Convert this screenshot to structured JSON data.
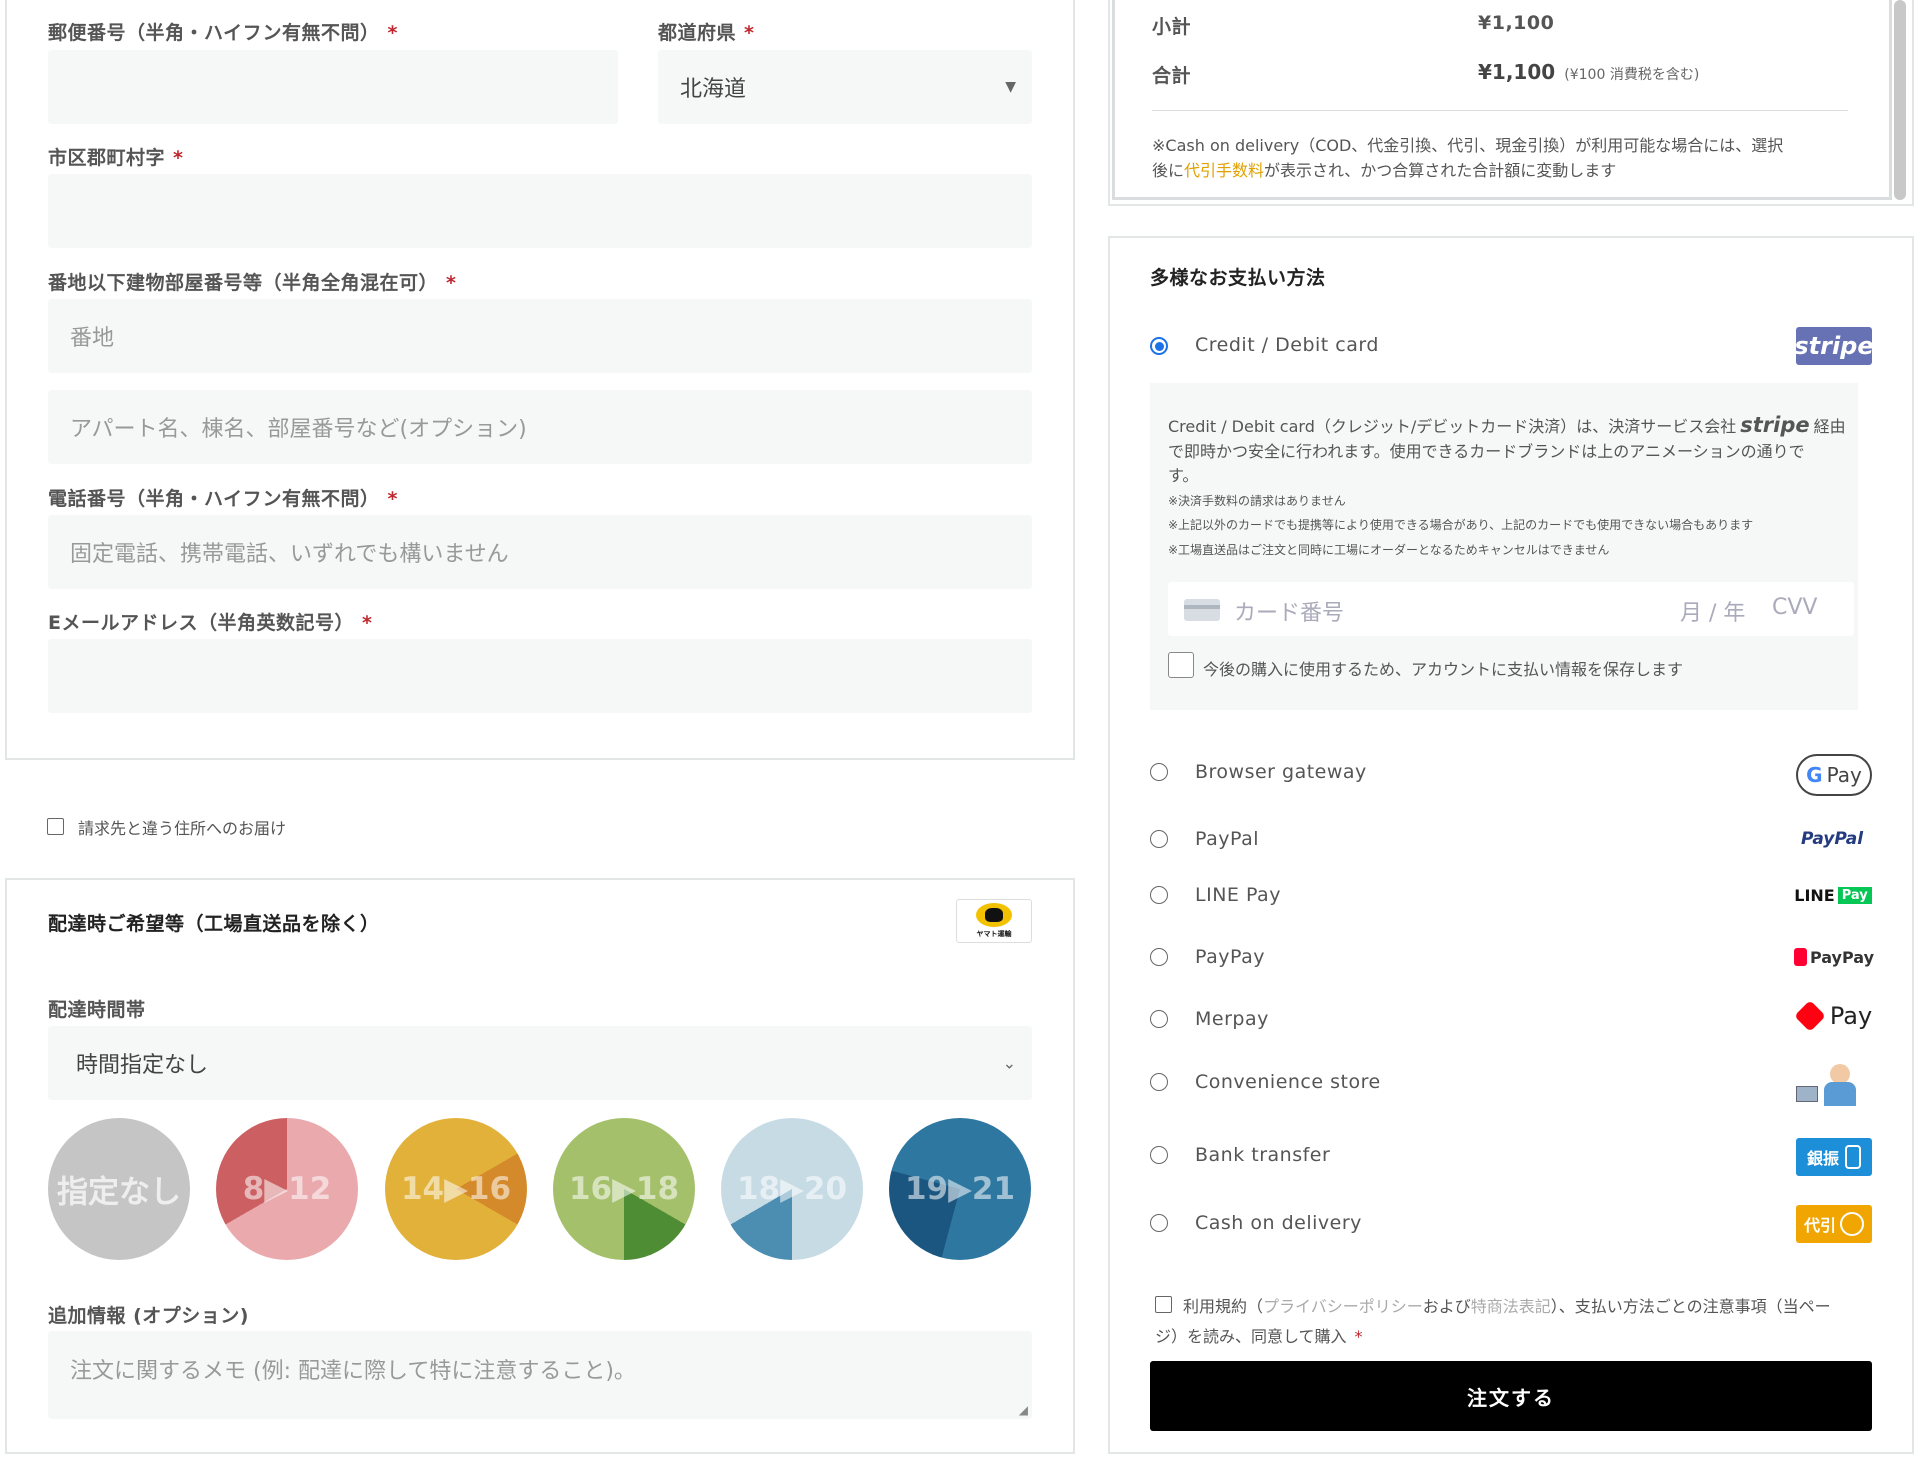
{
  "billing": {
    "postal_label": "郵便番号（半角・ハイフン有無不問）",
    "prefecture_label": "都道府県",
    "prefecture_value": "北海道",
    "city_label": "市区郡町村字",
    "address_label": "番地以下建物部屋番号等（半角全角混在可）",
    "address1_placeholder": "番地",
    "address2_placeholder": "アパート名、棟名、部屋番号など(オプション)",
    "phone_label": "電話番号（半角・ハイフン有無不問）",
    "phone_placeholder": "固定電話、携帯電話、いずれでも構いません",
    "email_label": "Eメールアドレス（半角英数記号）",
    "required_mark": "*"
  },
  "ship_diff_label": "請求先と違う住所へのお届け",
  "delivery": {
    "title": "配達時ご希望等（工場直送品を除く）",
    "carrier_logo_text": "ヤマト運輸",
    "time_label": "配達時間帯",
    "time_value": "時間指定なし",
    "slots": [
      "指定なし",
      "8▶12",
      "14▶16",
      "16▶18",
      "18▶20",
      "19▶21"
    ],
    "notes_label": "追加情報 (オプション)",
    "notes_placeholder": "注文に関するメモ (例: 配達に際して特に注意すること)。"
  },
  "summary": {
    "subtotal_label": "小計",
    "subtotal_value": "¥1,100",
    "total_label": "合計",
    "total_value": "¥1,100",
    "tax_note": "(¥100 消費税を含む)",
    "cod_note_1": "※Cash on delivery（COD、代金引換、代引、現金引換）が利用可能な場合には、選択",
    "cod_note_2a": "後に",
    "cod_note_2_link": "代引手数料",
    "cod_note_2b": "が表示され、かつ合算された合計額に変動します"
  },
  "payment": {
    "title": "多様なお支払い方法",
    "methods": [
      {
        "label": "Credit / Debit card",
        "selected": true,
        "logo": "stripe"
      },
      {
        "label": "Browser gateway",
        "selected": false,
        "logo": "G Pay"
      },
      {
        "label": "PayPal",
        "selected": false,
        "logo": "PayPal"
      },
      {
        "label": "LINE Pay",
        "selected": false,
        "logo": "LINE Pay"
      },
      {
        "label": "PayPay",
        "selected": false,
        "logo": "PayPay"
      },
      {
        "label": "Merpay",
        "selected": false,
        "logo": "Pay"
      },
      {
        "label": "Convenience store",
        "selected": false,
        "logo": "convenience-store-icon"
      },
      {
        "label": "Bank transfer",
        "selected": false,
        "logo": "銀振"
      },
      {
        "label": "Cash on delivery",
        "selected": false,
        "logo": "代引"
      }
    ],
    "card_desc_1a": "Credit / Debit card（クレジット/デビットカード決済）は、決済サービス会社",
    "card_desc_1_brand": "stripe",
    "card_desc_1b": "経由",
    "card_desc_2": "で即時かつ安全に行われます。使用できるカードブランドは上のアニメーションの通りで",
    "card_desc_3": "す。",
    "card_note_1": "※決済手数料の請求はありません",
    "card_note_2": "※上記以外のカードでも提携等により使用できる場合があり、上記のカードでも使用できない場合もあります",
    "card_note_3": "※工場直送品はご注文と同時に工場にオーダーとなるためキャンセルはできません",
    "card_number_placeholder": "カード番号",
    "expiry_placeholder": "月 / 年",
    "cvv_placeholder": "CVV",
    "save_card_label": "今後の購入に使用するため、アカウントに支払い情報を保存します",
    "terms_1a": "利用規約（",
    "terms_privacy": "プライバシーポリシー",
    "terms_1b": "および",
    "terms_law": "特商法表記",
    "terms_1c": "）、支払い方法ごとの注意事項（当ペー",
    "terms_2": "ジ）を読み、同意して購入",
    "order_button": "注文する"
  },
  "colors": {
    "accent": "#1a73e8",
    "required": "#c0262d",
    "link": "#e0a100",
    "button": "#000000"
  }
}
